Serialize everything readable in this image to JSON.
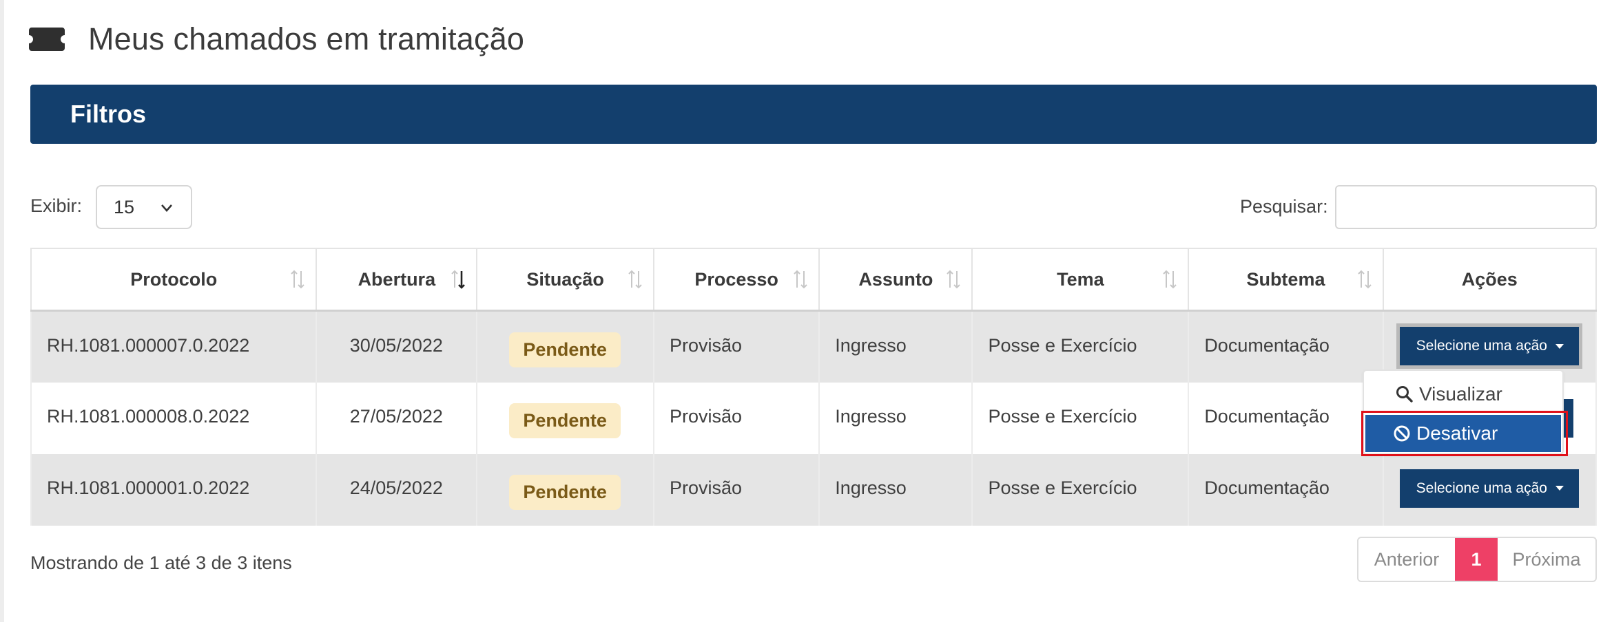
{
  "page": {
    "title": "Meus chamados em tramitação"
  },
  "filters": {
    "label": "Filtros"
  },
  "controls": {
    "show_label": "Exibir:",
    "show_value": "15",
    "search_label": "Pesquisar:",
    "search_value": ""
  },
  "table": {
    "columns": [
      "Protocolo",
      "Abertura",
      "Situação",
      "Processo",
      "Assunto",
      "Tema",
      "Subtema",
      "Ações"
    ],
    "rows": [
      {
        "protocolo": "RH.1081.000007.0.2022",
        "abertura": "30/05/2022",
        "situacao": "Pendente",
        "processo": "Provisão",
        "assunto": "Ingresso",
        "tema": "Posse e Exercício",
        "subtema": "Documentação",
        "acao": "Selecione uma ação"
      },
      {
        "protocolo": "RH.1081.000008.0.2022",
        "abertura": "27/05/2022",
        "situacao": "Pendente",
        "processo": "Provisão",
        "assunto": "Ingresso",
        "tema": "Posse e Exercício",
        "subtema": "Documentação",
        "acao": "Selecione uma ação"
      },
      {
        "protocolo": "RH.1081.000001.0.2022",
        "abertura": "24/05/2022",
        "situacao": "Pendente",
        "processo": "Provisão",
        "assunto": "Ingresso",
        "tema": "Posse e Exercício",
        "subtema": "Documentação",
        "acao": "Selecione uma ação"
      }
    ]
  },
  "dropdown": {
    "items": [
      "Visualizar",
      "Desativar"
    ]
  },
  "footer": {
    "info": "Mostrando de 1 até 3 de 3 itens",
    "prev": "Anterior",
    "current": "1",
    "next": "Próxima"
  },
  "colors": {
    "primary": "#133f6d",
    "badge_bg": "#fbecc7",
    "badge_text": "#7a5a17",
    "active_page": "#ee4066",
    "menu_highlight": "#1f5ca5",
    "annotation": "#e0111a"
  },
  "icons": {
    "title": "ticket-icon",
    "select": "chevron-down-icon",
    "sort": "sort-icon",
    "view": "search-icon",
    "deactivate": "ban-icon"
  }
}
